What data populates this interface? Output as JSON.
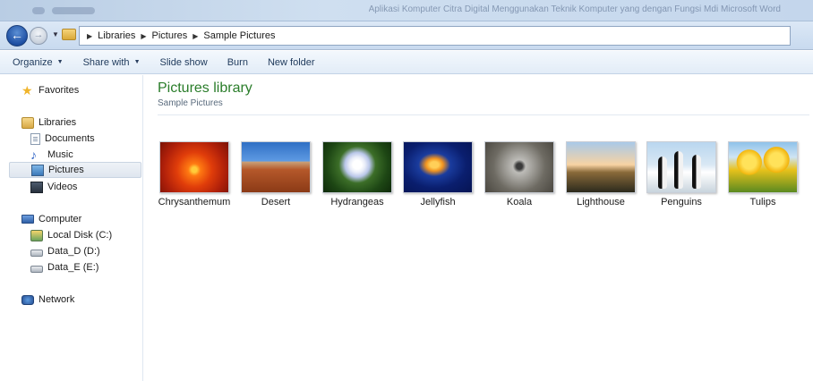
{
  "window": {
    "title": "Aplikasi Komputer Citra Digital Menggunakan Teknik Komputer yang dengan Fungsi Mdi Microsoft Word"
  },
  "address": {
    "crumbs": [
      "Libraries",
      "Pictures",
      "Sample Pictures"
    ]
  },
  "toolbar": {
    "organize": "Organize",
    "share_with": "Share with",
    "slide_show": "Slide show",
    "burn": "Burn",
    "new_folder": "New folder"
  },
  "navpane": {
    "favorites": "Favorites",
    "libraries": "Libraries",
    "documents": "Documents",
    "music": "Music",
    "pictures": "Pictures",
    "videos": "Videos",
    "computer": "Computer",
    "local_disk": "Local Disk (C:)",
    "data_d": "Data_D (D:)",
    "data_e": "Data_E (E:)",
    "network": "Network",
    "selected": "Pictures"
  },
  "library": {
    "title": "Pictures library",
    "subtitle": "Sample Pictures",
    "items": [
      "Chrysanthemum",
      "Desert",
      "Hydrangeas",
      "Jellyfish",
      "Koala",
      "Lighthouse",
      "Penguins",
      "Tulips"
    ]
  },
  "colors": {
    "library_title": "#2a7d2a",
    "toolbar_text": "#1e395b"
  },
  "icons": {
    "back": "back-arrow-icon",
    "forward": "forward-arrow-icon",
    "favorites": "star-icon",
    "libraries": "library-icon",
    "documents": "document-icon",
    "music": "music-note-icon",
    "pictures": "pictures-icon",
    "videos": "video-icon",
    "computer": "computer-icon",
    "disk": "drive-icon",
    "network": "network-icon"
  }
}
